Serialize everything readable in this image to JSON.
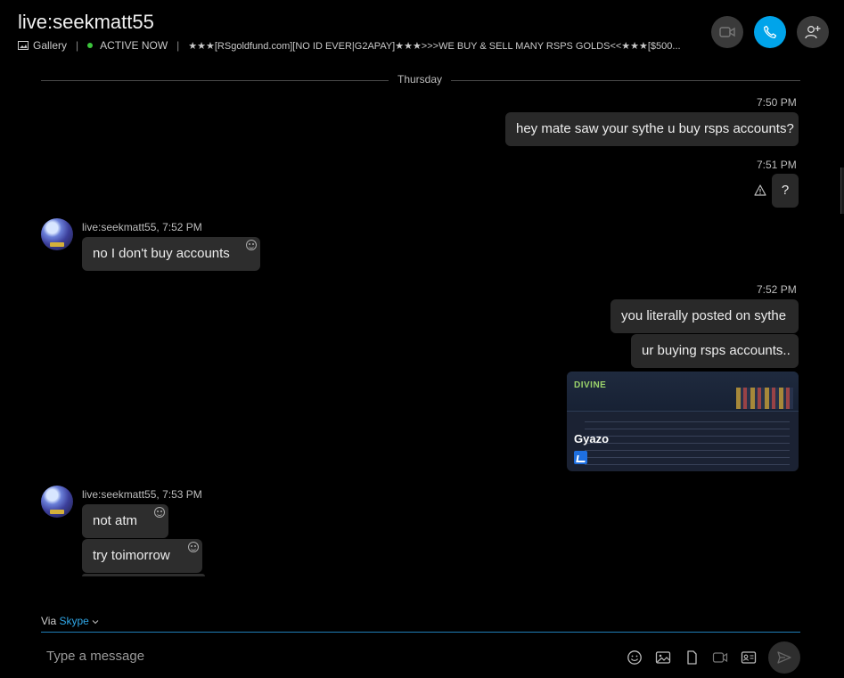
{
  "header": {
    "title": "live:seekmatt55",
    "gallery_label": "Gallery",
    "status_label": "ACTIVE NOW",
    "mood": "★★★[RSgoldfund.com][NO ID EVER|G2APAY]★★★>>>WE BUY & SELL MANY RSPS GOLDS<<★★★[$500..."
  },
  "divider": {
    "label": "Thursday"
  },
  "messages": [
    {
      "time": "7:50 PM",
      "text": "hey mate saw your sythe u buy rsps accounts?"
    },
    {
      "time": "7:51 PM",
      "text": "?"
    },
    {
      "sender": "live:seekmatt55,",
      "time": "7:52 PM",
      "text": "no I don't buy accounts"
    },
    {
      "time": "7:52 PM",
      "text": "you literally posted on sythe"
    },
    {
      "text": "ur buying rsps accounts.."
    },
    {
      "preview_brand": "Gyazo",
      "preview_logo": "DIVINE"
    },
    {
      "sender": "live:seekmatt55,",
      "time": "7:53 PM",
      "text": "not atm"
    },
    {
      "text": "try toimorrow"
    }
  ],
  "composer": {
    "via_label": "Via",
    "via_link": "Skype",
    "placeholder": "Type a message"
  },
  "colors": {
    "accent": "#00a4ea",
    "online": "#3cc43c",
    "bubble": "#292929",
    "background": "#000000"
  }
}
